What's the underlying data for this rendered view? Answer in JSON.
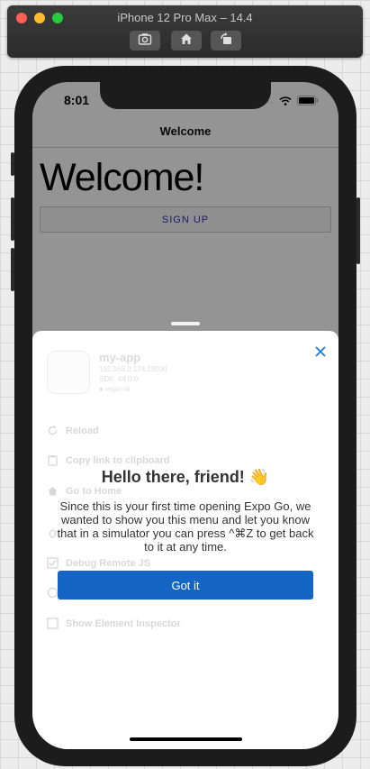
{
  "simulator": {
    "title": "iPhone 12 Pro Max – 14.4",
    "buttons": [
      "camera-icon",
      "home-icon",
      "rotate-icon"
    ]
  },
  "status_bar": {
    "time": "8:01"
  },
  "app": {
    "nav_title": "Welcome",
    "heading": "Welcome!",
    "signup_label": "SIGN UP"
  },
  "dev_menu": {
    "app_name": "my-app",
    "meta_lines": [
      "192.168.0.124:19000",
      "SDK: 44.0.0",
      "● expo-cli"
    ],
    "items": [
      {
        "label": "Reload",
        "icon": "reload-icon"
      },
      {
        "label": "Copy link to clipboard",
        "icon": "clipboard-icon"
      },
      {
        "label": "Go to Home",
        "icon": "home-icon"
      },
      {
        "label": "",
        "icon": "bug-icon"
      },
      {
        "label": "Debug Remote JS",
        "icon": "checkbox-icon"
      },
      {
        "label": "",
        "icon": "performance-icon"
      },
      {
        "label": "Show Element Inspector",
        "icon": "inspector-icon"
      }
    ]
  },
  "onboarding": {
    "title": "Hello there, friend! 👋",
    "message": "Since this is your first time opening Expo Go, we wanted to show you this menu and let you know that in a simulator you can press ^⌘Z to get back to it at any time.",
    "button_label": "Got it"
  },
  "colors": {
    "accent": "#1565c4",
    "signup_text": "#3b2db0",
    "close_icon": "#1d7ad8"
  }
}
